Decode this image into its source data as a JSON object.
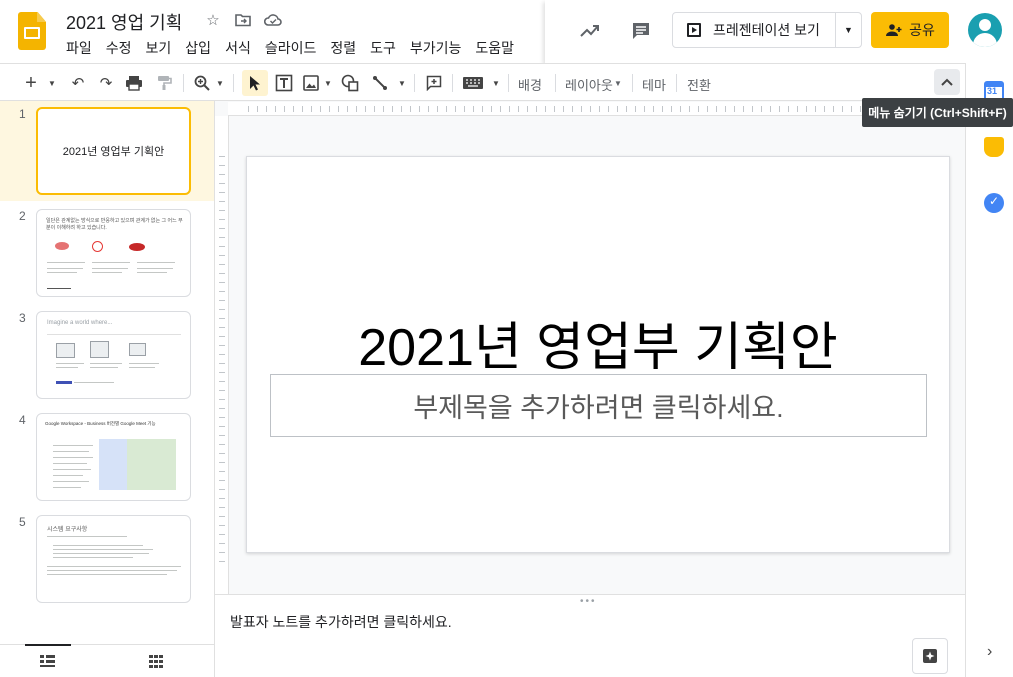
{
  "app": {
    "doc_title": "2021 영업 기획",
    "menus": [
      "파일",
      "수정",
      "보기",
      "삽입",
      "서식",
      "슬라이드",
      "정렬",
      "도구",
      "부가기능",
      "도움말"
    ]
  },
  "header": {
    "present_label": "프레젠테이션 보기",
    "share_label": "공유"
  },
  "toolbar": {
    "background_label": "배경",
    "layout_label": "레이아웃",
    "theme_label": "테마",
    "transition_label": "전환",
    "tooltip": "메뉴 숨기기 (Ctrl+Shift+F)"
  },
  "filmstrip": {
    "slides": [
      {
        "num": "1",
        "title": "2021년 영업부 기획안"
      },
      {
        "num": "2",
        "heading": "일단은 관계없는 방식으로 반응하고 있으며 관계가 없는 그 어느 부분이 이해하려 하고 있습니다."
      },
      {
        "num": "3",
        "heading": "Imagine a world where..."
      },
      {
        "num": "4",
        "heading": "Google Workspace - Business 버전별 Google Meet 기능"
      },
      {
        "num": "5",
        "heading": "시스템 요구사항"
      }
    ]
  },
  "slide": {
    "title": "2021년 영업부 기획안",
    "subtitle_placeholder": "부제목을 추가하려면 클릭하세요."
  },
  "notes": {
    "placeholder": "발표자 노트를 추가하려면 클릭하세요."
  },
  "side_panel": {
    "calendar_day": "31"
  }
}
